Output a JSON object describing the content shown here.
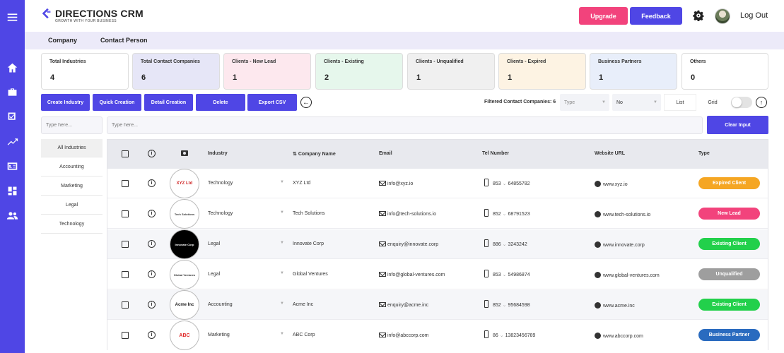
{
  "brand": {
    "name": "DIRECTIONS CRM",
    "tagline": "GROWTH WITH YOUR BUSINESS",
    "accent": "#4f46e5"
  },
  "header": {
    "upgrade_label": "Upgrade",
    "feedback_label": "Feedback",
    "logout_label": "Log Out"
  },
  "subnav": {
    "tabs": [
      "Company",
      "Contact Person"
    ]
  },
  "stats": [
    {
      "label": "Total Industries",
      "value": "4",
      "color": "#ffffff"
    },
    {
      "label": "Total Contact Companies",
      "value": "6",
      "color": "#e6e6f7"
    },
    {
      "label": "Clients - New Lead",
      "value": "1",
      "color": "#fde8ee"
    },
    {
      "label": "Clients - Existing",
      "value": "2",
      "color": "#e6f7ec"
    },
    {
      "label": "Clients - Unqualified",
      "value": "1",
      "color": "#f0f0f0"
    },
    {
      "label": "Clients - Expired",
      "value": "1",
      "color": "#fdf3e3"
    },
    {
      "label": "Business Partners",
      "value": "1",
      "color": "#e8eefa"
    },
    {
      "label": "Others",
      "value": "0",
      "color": "#ffffff"
    }
  ],
  "actions": {
    "create_industry": "Create Industry",
    "quick_creation": "Quick Creation",
    "detail_creation": "Detail Creation",
    "delete": "Delete",
    "export_csv": "Export CSV"
  },
  "filters": {
    "count_label": "Filtered Contact Companies: 6",
    "type_placeholder": "Type",
    "no_value": "No",
    "list_label": "List",
    "grid_label": "Grid"
  },
  "search": {
    "industry_placeholder": "Type here...",
    "main_placeholder": "Type here...",
    "clear_label": "Clear Input"
  },
  "industries": [
    "All Industries",
    "Accounting",
    "Marketing",
    "Legal",
    "Technology"
  ],
  "table": {
    "columns": {
      "industry": "Industry",
      "company": "Company Name",
      "email": "Email",
      "tel": "Tel Number",
      "website": "Website URL",
      "type": "Type"
    },
    "rows": [
      {
        "logo": "XYZ Ltd",
        "industry": "Technology",
        "company": "XYZ Ltd",
        "email": "info@xyz.io",
        "code": "853",
        "tel": "64855782",
        "website": "www.xyz.io",
        "type": "Expired Client",
        "type_color": "#f5a623"
      },
      {
        "logo": "Tech Solutions",
        "industry": "Technology",
        "company": "Tech Solutions",
        "email": "info@tech-solutions.io",
        "code": "852",
        "tel": "68791523",
        "website": "www.tech-solutions.io",
        "type": "New Lead",
        "type_color": "#f2437c"
      },
      {
        "logo": "Innovate Corp",
        "industry": "Legal",
        "company": "Innovate Corp",
        "email": "enquiry@innovate.corp",
        "code": "886",
        "tel": "3243242",
        "website": "www.innovate.corp",
        "type": "Existing Client",
        "type_color": "#22d04b"
      },
      {
        "logo": "Global Ventures",
        "industry": "Legal",
        "company": "Global Ventures",
        "email": "info@global-ventures.com",
        "code": "853",
        "tel": "54986874",
        "website": "www.global-ventures.com",
        "type": "Unqualified",
        "type_color": "#9e9e9e"
      },
      {
        "logo": "Acme Inc",
        "industry": "Accounting",
        "company": "Acme Inc",
        "email": "enquiry@acme.inc",
        "code": "852",
        "tel": "95684598",
        "website": "www.acme.inc",
        "type": "Existing Client",
        "type_color": "#22d04b"
      },
      {
        "logo": "ABC",
        "industry": "Marketing",
        "company": "ABC Corp",
        "email": "info@abccorp.com",
        "code": "86",
        "tel": "13823456789",
        "website": "www.abccorp.com",
        "type": "Business Partner",
        "type_color": "#2a6bbf"
      }
    ]
  }
}
